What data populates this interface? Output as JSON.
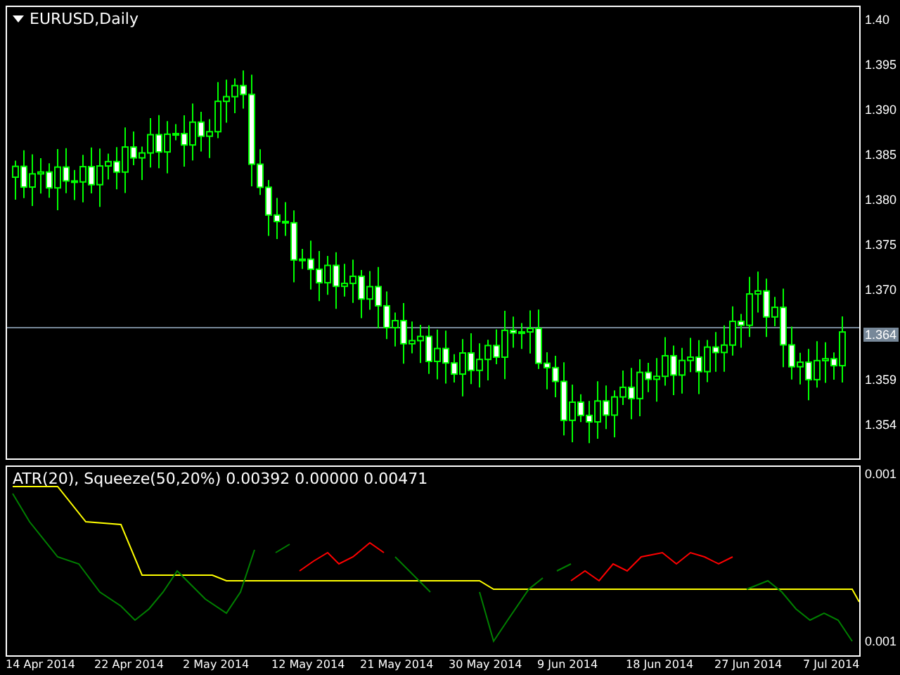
{
  "main_chart": {
    "title": "EURUSD,Daily",
    "price_axis": [
      {
        "label": "1.40",
        "kind": "tick"
      },
      {
        "label": "1.395",
        "kind": "tick"
      },
      {
        "label": "1.390",
        "kind": "tick"
      },
      {
        "label": "1.385",
        "kind": "tick"
      },
      {
        "label": "1.380",
        "kind": "tick"
      },
      {
        "label": "1.375",
        "kind": "tick"
      },
      {
        "label": "1.370",
        "kind": "tick"
      },
      {
        "label": "1.364",
        "kind": "current"
      },
      {
        "label": "1.359",
        "kind": "tick"
      },
      {
        "label": "1.354",
        "kind": "tick"
      }
    ]
  },
  "indicator": {
    "title": "ATR(20), Squeeze(50,20%) 0.00392 0.00000 0.00471",
    "axis": [
      "0.001",
      "0.001"
    ]
  },
  "time_axis": [
    "14 Apr 2014",
    "22 Apr 2014",
    "2 May 2014",
    "12 May 2014",
    "21 May 2014",
    "30 May 2014",
    "9 Jun 2014",
    "18 Jun 2014",
    "27 Jun 2014",
    "7 Jul 2014"
  ]
}
